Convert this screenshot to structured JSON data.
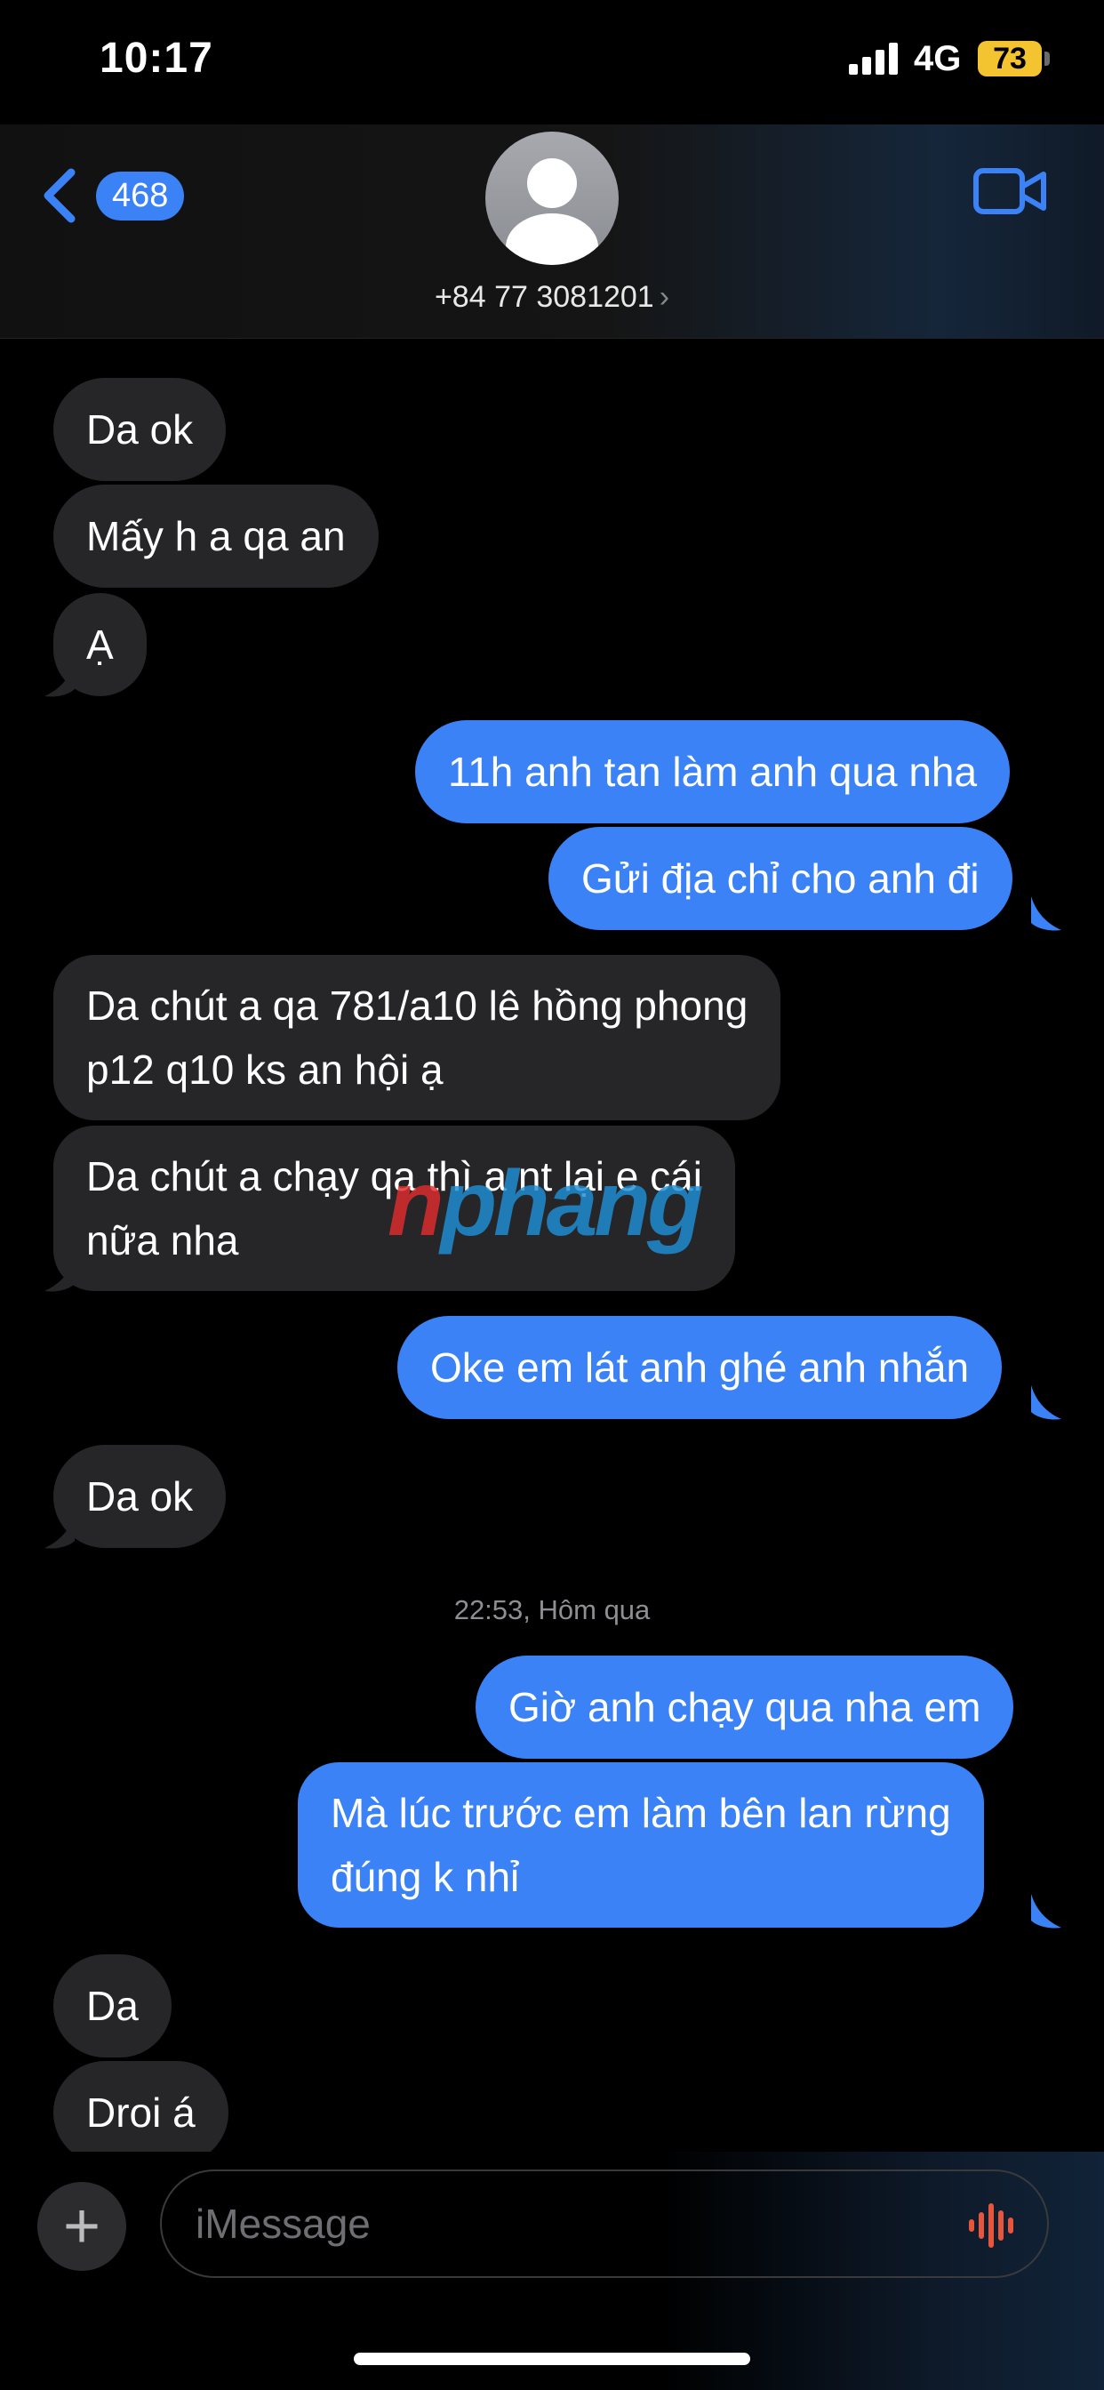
{
  "status_bar": {
    "time": "10:17",
    "network": "4G",
    "battery": "73"
  },
  "header": {
    "back_count": "468",
    "contact_name": "+84 77 3081201",
    "contact_chevron": "›"
  },
  "messages": {
    "m1": "Da ok",
    "m2": "Mấy h a qa an",
    "m3": "Ạ",
    "m4": "11h anh tan làm anh qua nha",
    "m5": "Gửi địa chỉ cho anh đi",
    "m6_line1": "Da chút a qa 781/a10 lê hồng phong",
    "m6_line2": "p12 q10 ks an hội ạ",
    "m7_line1": "Da chút a chạy qa thì a nt lại e cái",
    "m7_line2": "nữa nha",
    "m8": "Oke em lát anh ghé anh nhắn",
    "m9": "Da ok",
    "timestamp": "22:53, Hôm qua",
    "m10": "Giờ anh chạy qua nha em",
    "m11_line1": "Mà lúc trước em làm bên lan rừng",
    "m11_line2": "đúng k nhỉ",
    "m12": "Da",
    "m13": "Droi á"
  },
  "watermark": {
    "first": "n",
    "rest": "phang"
  },
  "input": {
    "placeholder": "iMessage",
    "plus_label": "+"
  },
  "colors": {
    "outgoing_bubble": "#3a82f6",
    "incoming_bubble": "#262628",
    "battery": "#f4c430"
  },
  "icons": [
    "chevron-left-icon",
    "avatar-icon",
    "video-camera-icon",
    "plus-icon",
    "voice-waveform-icon",
    "signal-icon"
  ]
}
